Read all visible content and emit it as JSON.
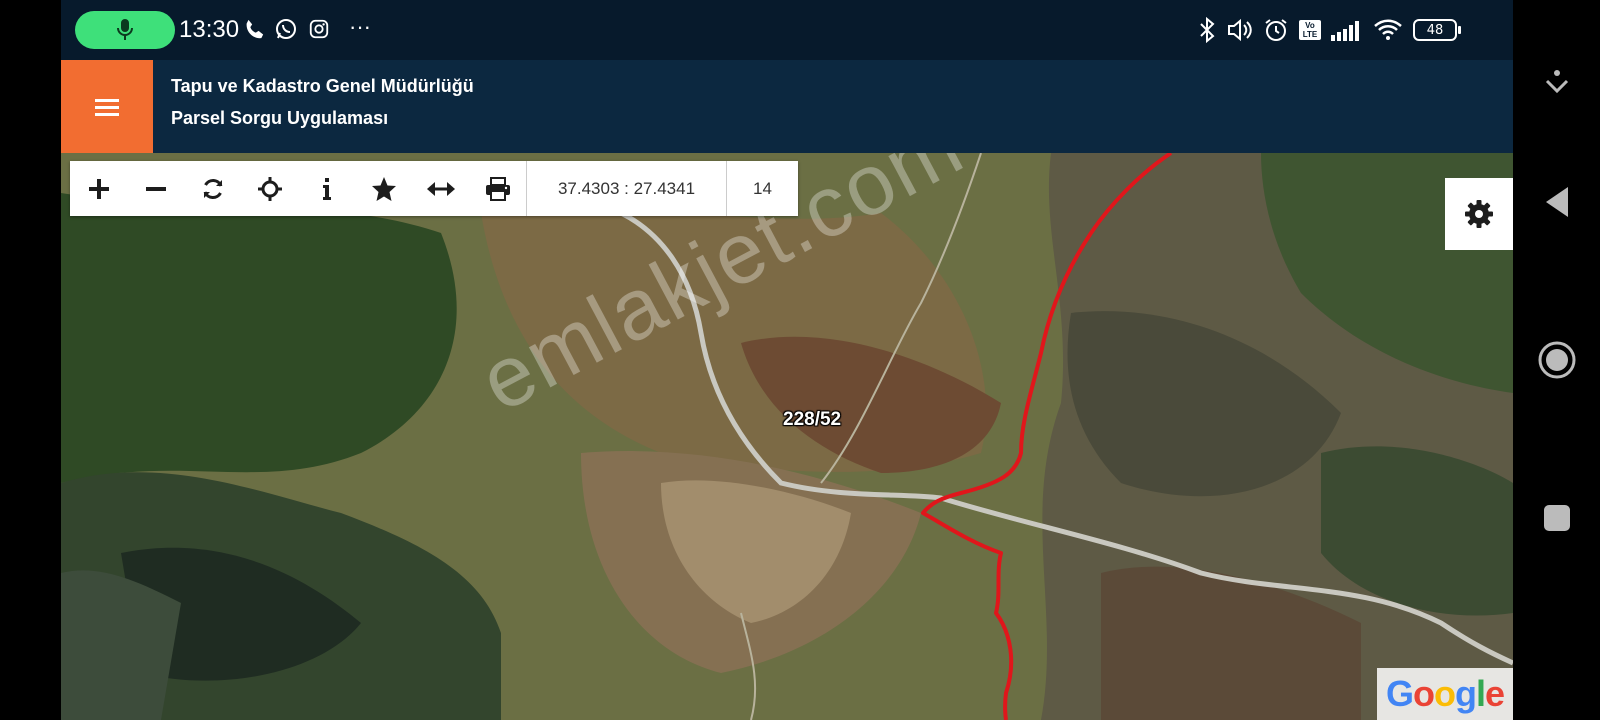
{
  "status_bar": {
    "time": "13:30",
    "battery": "48",
    "left_icons": [
      "mic-icon",
      "phone-icon",
      "whatsapp-icon",
      "instagram-icon",
      "more-icon"
    ],
    "right_icons": [
      "bluetooth-icon",
      "volume-icon",
      "alarm-icon",
      "volte-icon",
      "signal-icon",
      "wifi-icon",
      "battery-icon"
    ],
    "more": "···",
    "volte": "Vo LTE"
  },
  "header": {
    "title": "Tapu ve Kadastro Genel Müdürlüğü",
    "subtitle": "Parsel Sorgu Uygulaması",
    "menu_icon": "hamburger-menu-icon",
    "menu_color": "#f26d31",
    "bg_color": "#0c2840"
  },
  "toolbar": {
    "tools": [
      {
        "name": "zoom-in",
        "icon": "plus-icon",
        "glyph": "+"
      },
      {
        "name": "zoom-out",
        "icon": "minus-icon",
        "glyph": "−"
      },
      {
        "name": "refresh",
        "icon": "refresh-icon",
        "glyph": ""
      },
      {
        "name": "locate",
        "icon": "crosshair-icon",
        "glyph": ""
      },
      {
        "name": "info",
        "icon": "info-icon",
        "glyph": "i"
      },
      {
        "name": "favorite",
        "icon": "star-icon",
        "glyph": "★"
      },
      {
        "name": "measure",
        "icon": "arrows-horizontal-icon",
        "glyph": "⟷"
      },
      {
        "name": "print",
        "icon": "printer-icon",
        "glyph": ""
      }
    ],
    "coordinates": "37.4303 : 27.4341",
    "zoom_level": "14"
  },
  "map": {
    "parcel_label": "228/52",
    "watermark": "emlakjet.com",
    "attribution": "Google",
    "boundary_color": "#e0161b",
    "settings_icon": "gear-icon"
  },
  "navigation": {
    "buttons": [
      "download-icon",
      "back-icon",
      "home-icon",
      "recents-icon"
    ]
  }
}
